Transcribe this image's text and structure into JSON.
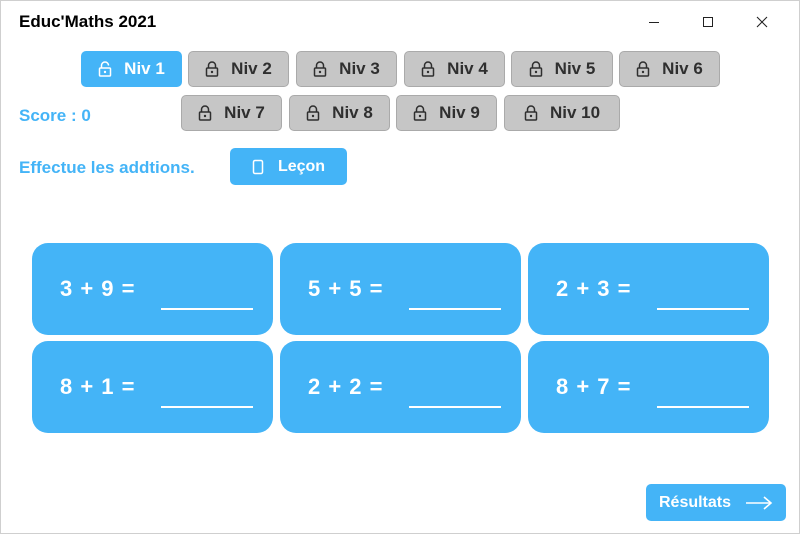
{
  "window": {
    "title": "Educ'Maths 2021",
    "controls": [
      "minimize-icon",
      "maximize-icon",
      "close-icon"
    ]
  },
  "levels": [
    {
      "label": "Niv 1",
      "state": "active",
      "icon": "unlock-icon"
    },
    {
      "label": "Niv 2",
      "state": "locked",
      "icon": "lock-icon"
    },
    {
      "label": "Niv 3",
      "state": "locked",
      "icon": "lock-icon"
    },
    {
      "label": "Niv 4",
      "state": "locked",
      "icon": "lock-icon"
    },
    {
      "label": "Niv 5",
      "state": "locked",
      "icon": "lock-icon"
    },
    {
      "label": "Niv 6",
      "state": "locked",
      "icon": "lock-icon"
    },
    {
      "label": "Niv 7",
      "state": "locked",
      "icon": "lock-icon"
    },
    {
      "label": "Niv 8",
      "state": "locked",
      "icon": "lock-icon"
    },
    {
      "label": "Niv 9",
      "state": "locked",
      "icon": "lock-icon"
    },
    {
      "label": "Niv 10",
      "state": "locked",
      "icon": "lock-icon"
    }
  ],
  "score": {
    "text": "Score : 0"
  },
  "instruction": "Effectue les addtions.",
  "lesson_button": {
    "label": "Leçon",
    "icon": "book-icon"
  },
  "exercises": [
    {
      "equation": "3 + 9 =",
      "answer": ""
    },
    {
      "equation": "5 + 5 =",
      "answer": ""
    },
    {
      "equation": "2 + 3 =",
      "answer": ""
    },
    {
      "equation": "8 + 1 =",
      "answer": ""
    },
    {
      "equation": "2 + 2 =",
      "answer": ""
    },
    {
      "equation": "8 + 7 =",
      "answer": ""
    }
  ],
  "results_button": {
    "label": "Résultats",
    "icon": "arrow-right-icon"
  },
  "colors": {
    "accent": "#44b4f7",
    "locked_bg": "#c6c6c6",
    "locked_text": "#2f2f2f"
  }
}
